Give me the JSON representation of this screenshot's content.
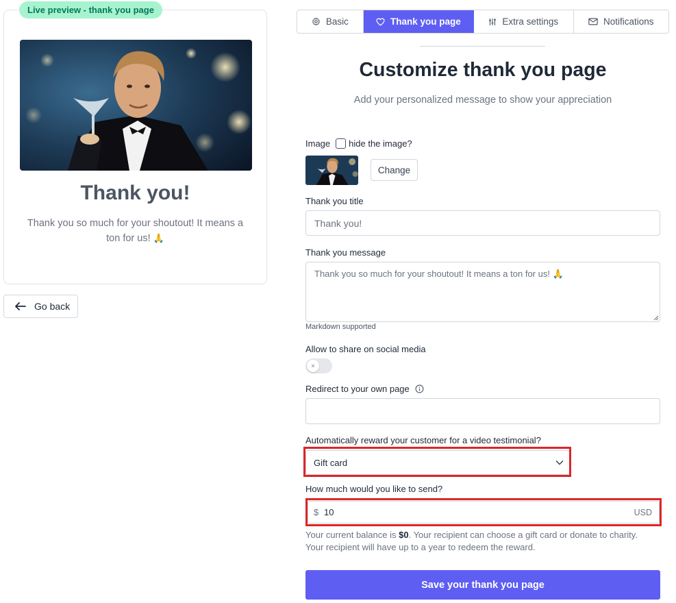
{
  "preview": {
    "badge": "Live preview - thank you page",
    "title": "Thank you!",
    "message": "Thank you so much for your shoutout! It means a ton for us!",
    "emoji": "🙏",
    "go_back": "Go back"
  },
  "tabs": [
    {
      "label": "Basic",
      "icon": "gear-icon",
      "active": false
    },
    {
      "label": "Thank you page",
      "icon": "heart-icon",
      "active": true
    },
    {
      "label": "Extra settings",
      "icon": "sliders-icon",
      "active": false
    },
    {
      "label": "Notifications",
      "icon": "envelope-icon",
      "active": false
    }
  ],
  "form": {
    "heading": "Customize thank you page",
    "subheading": "Add your personalized message to show your appreciation",
    "image": {
      "label": "Image",
      "hide_label": "hide the image?",
      "hide_checked": false,
      "change_button": "Change"
    },
    "thank_title": {
      "label": "Thank you title",
      "value": "Thank you!"
    },
    "thank_message": {
      "label": "Thank you message",
      "value": "Thank you so much for your shoutout! It means a ton for us!",
      "emoji": "🙏",
      "hint": "Markdown supported"
    },
    "share": {
      "label": "Allow to share on social media",
      "enabled": false
    },
    "redirect": {
      "label": "Redirect to your own page",
      "value": ""
    },
    "reward": {
      "label": "Automatically reward your customer for a video testimonial?",
      "selected": "Gift card"
    },
    "amount": {
      "label": "How much would you like to send?",
      "prefix": "$",
      "value": "10",
      "currency": "USD"
    },
    "balance": {
      "prefix": "Your current balance is ",
      "amount": "$0",
      "suffix": ". Your recipient can choose a gift card or donate to charity.",
      "line2": "Your recipient will have up to a year to redeem the reward."
    },
    "save_button": "Save your thank you page"
  },
  "colors": {
    "accent": "#5f5ef2",
    "badge_bg": "#a7f3d0",
    "badge_text": "#047857",
    "highlight": "#dc2626"
  }
}
